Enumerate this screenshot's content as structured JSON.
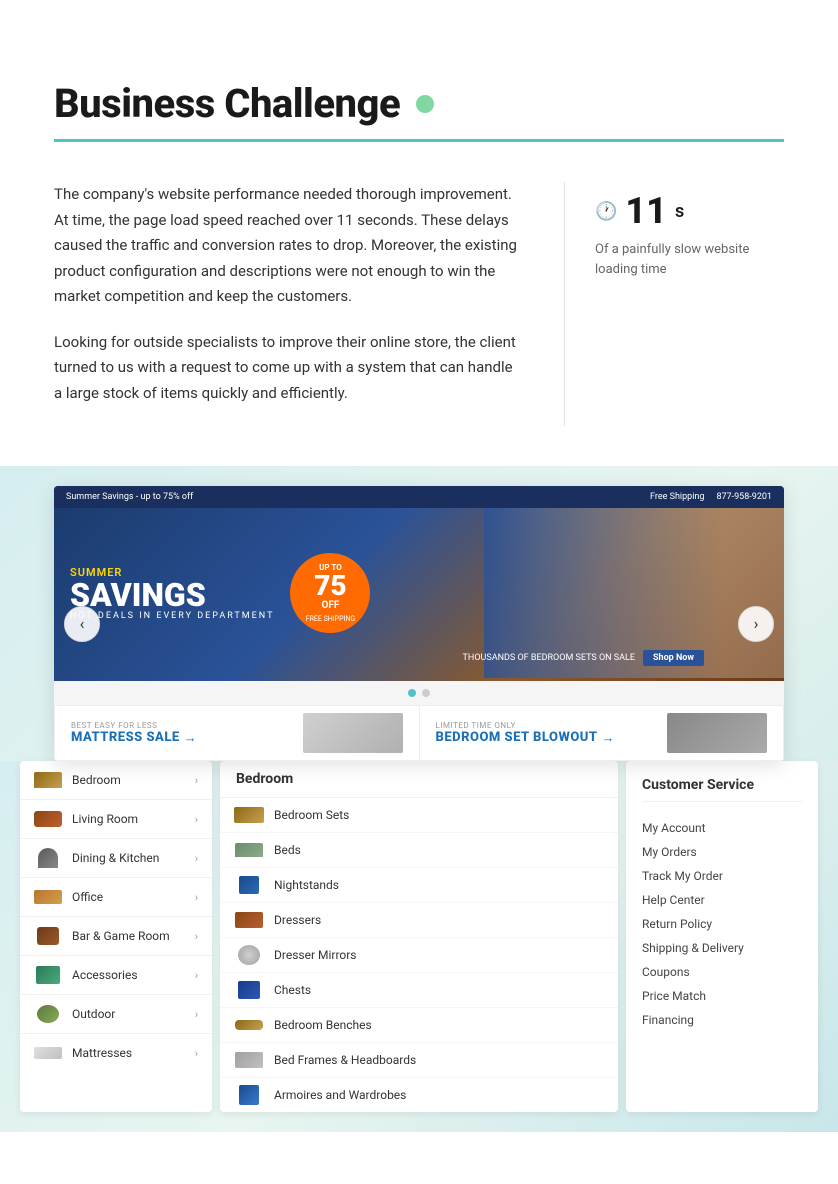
{
  "page": {
    "title": "Business Challenge"
  },
  "challenge": {
    "title": "Business Challenge",
    "dot_color": "#7ed8a0",
    "paragraph1": "The company's website performance needed thorough improvement. At time, the page load speed reached over 11 seconds. These delays caused the traffic and conversion rates to drop. Moreover, the existing product configuration and descriptions were not enough to win the market competition and keep the customers.",
    "paragraph2": "Looking for outside specialists to improve their online store, the client turned to us with a request to come up with a system that can handle a large stock of items quickly and efficiently.",
    "stat": {
      "number": "11",
      "unit": "s",
      "description": "Of a painfully slow website loading time"
    }
  },
  "carousel": {
    "banner": {
      "top_bar_left": "Summer Savings - up to 75% off",
      "top_bar_right1": "Free Shipping",
      "top_bar_right2": "877-958-9201",
      "sub_text": "Summer",
      "main_text": "SAVINGS",
      "tagline": "HOT DEALS IN EVERY DEPARTMENT",
      "discount_up_to": "UP TO",
      "discount_pct": "75",
      "discount_off": "OFF",
      "discount_free": "FREE SHIPPING",
      "sale_text": "Thousands of Bedroom Sets on Sale",
      "shop_now": "Shop Now"
    },
    "dots": [
      "active",
      "inactive"
    ],
    "sub_banners": [
      {
        "label": "BEST EASY FOR LESS",
        "title": "MATTRESS SALE",
        "arrow": "→"
      },
      {
        "label": "LIMITED TIME ONLY",
        "title": "BEDROOM SET BLOWOUT",
        "arrow": "→"
      }
    ]
  },
  "left_menu": {
    "items": [
      {
        "label": "Bedroom",
        "icon": "bed"
      },
      {
        "label": "Living Room",
        "icon": "sofa"
      },
      {
        "label": "Dining & Kitchen",
        "icon": "chair"
      },
      {
        "label": "Office",
        "icon": "desk"
      },
      {
        "label": "Bar & Game Room",
        "icon": "bar"
      },
      {
        "label": "Accessories",
        "icon": "acc"
      },
      {
        "label": "Outdoor",
        "icon": "outdoor"
      },
      {
        "label": "Mattresses",
        "icon": "mattress"
      }
    ]
  },
  "middle_menu": {
    "header": "Bedroom",
    "items": [
      {
        "label": "Bedroom Sets",
        "icon": "bedroom-set"
      },
      {
        "label": "Beds",
        "icon": "bed"
      },
      {
        "label": "Nightstands",
        "icon": "nightstand"
      },
      {
        "label": "Dressers",
        "icon": "dresser"
      },
      {
        "label": "Dresser Mirrors",
        "icon": "mirror"
      },
      {
        "label": "Chests",
        "icon": "chest"
      },
      {
        "label": "Bedroom Benches",
        "icon": "bench"
      },
      {
        "label": "Bed Frames & Headboards",
        "icon": "frame"
      },
      {
        "label": "Armoires and Wardrobes",
        "icon": "armoire"
      }
    ]
  },
  "right_menu": {
    "header": "Customer Service",
    "items": [
      "My Account",
      "My Orders",
      "Track My Order",
      "Help Center",
      "Return Policy",
      "Shipping & Delivery",
      "Coupons",
      "Price Match",
      "Financing"
    ]
  }
}
